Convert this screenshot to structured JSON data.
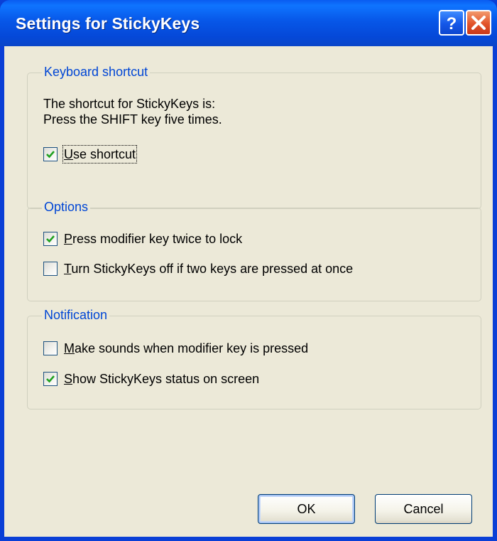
{
  "window": {
    "title": "Settings for StickyKeys"
  },
  "keyboard_shortcut": {
    "label": "Keyboard shortcut",
    "line1": "The shortcut for StickyKeys is:",
    "line2": "Press the SHIFT key five times.",
    "use_shortcut": {
      "mnemonic": "U",
      "rest": "se shortcut",
      "checked": true
    }
  },
  "options": {
    "label": "Options",
    "press_modifier_twice": {
      "mnemonic": "P",
      "rest": "ress modifier key twice to lock",
      "checked": true
    },
    "turn_off_two_keys": {
      "mnemonic": "T",
      "rest": "urn StickyKeys off if two keys are pressed at once",
      "checked": false
    }
  },
  "notification": {
    "label": "Notification",
    "make_sounds": {
      "mnemonic": "M",
      "rest": "ake sounds when modifier key is pressed",
      "checked": false
    },
    "show_status": {
      "mnemonic": "S",
      "rest": "how StickyKeys status on screen",
      "checked": true
    }
  },
  "buttons": {
    "ok": "OK",
    "cancel": "Cancel"
  },
  "icons": {
    "help": "help-icon",
    "close": "close-icon",
    "check": "checkmark-icon"
  },
  "colors": {
    "titlebar": "#0757e8",
    "group_label": "#0046d5",
    "dialog_background": "#ece9d8",
    "checkmark": "#21a121",
    "close_button": "#e2532a"
  }
}
